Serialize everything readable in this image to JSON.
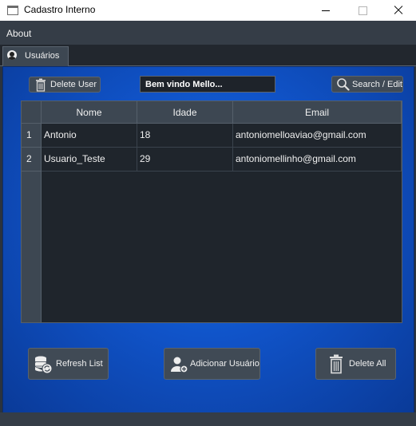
{
  "window": {
    "title": "Cadastro Interno"
  },
  "menu": {
    "about": "About"
  },
  "tab": {
    "label": "Usuários",
    "icon": "user-icon"
  },
  "toolbar": {
    "delete_user": "Delete User",
    "welcome": "Bem vindo Mello...",
    "search_edit": "Search / Edit"
  },
  "table": {
    "columns": [
      "Nome",
      "Idade",
      "Email"
    ],
    "row_headers": [
      "1",
      "2"
    ],
    "rows": [
      [
        "Antonio",
        "18",
        "antoniomelloaviao@gmail.com"
      ],
      [
        "Usuario_Teste",
        "29",
        "antoniomellinho@gmail.com"
      ]
    ]
  },
  "buttons": {
    "refresh": "Refresh List",
    "add_user": "Adicionar Usuário",
    "delete_all": "Delete All"
  },
  "colors": {
    "panel_blue": "#1053c8",
    "dark_bg": "#2b333d",
    "button": "#404a55",
    "table_bg": "#1f252c"
  }
}
